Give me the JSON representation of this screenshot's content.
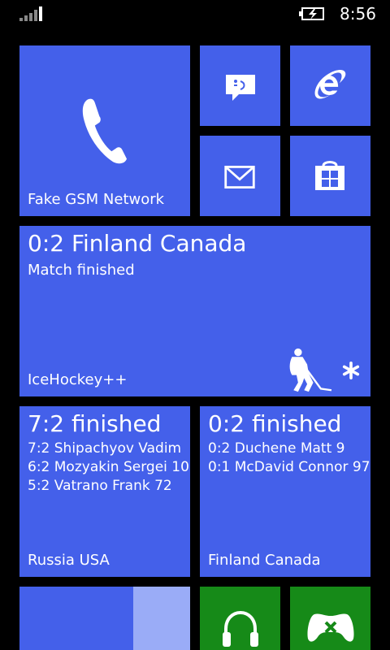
{
  "status_bar": {
    "time": "8:56",
    "signal_icon": "cellular-signal-icon",
    "battery_icon": "battery-charging-icon"
  },
  "tiles": {
    "phone": {
      "label": "Fake GSM Network",
      "icon": "phone-icon"
    },
    "messaging": {
      "icon": "messaging-icon"
    },
    "internet_explorer": {
      "icon": "internet-explorer-icon"
    },
    "mail": {
      "icon": "mail-icon"
    },
    "store": {
      "icon": "store-icon"
    },
    "icehockey": {
      "title": "0:2 Finland Canada",
      "subtitle": "Match finished",
      "label": "IceHockey++",
      "icon": "hockey-player-icon",
      "badge_icon": "asterisk-icon"
    },
    "russia_usa": {
      "title": "7:2 finished",
      "lines": [
        "7:2 Shipachyov Vadim",
        "6:2 Mozyakin Sergei 10",
        "5:2 Vatrano Frank 72"
      ],
      "label": "Russia USA"
    },
    "finland_canada": {
      "title": "0:2 finished",
      "lines": [
        "0:2 Duchene Matt 9",
        "0:1 McDavid Connor 97"
      ],
      "label": "Finland Canada"
    },
    "music": {
      "icon": "headphones-icon"
    },
    "xbox": {
      "icon": "xbox-controller-icon"
    }
  },
  "colors": {
    "accent": "#4460ea",
    "accent_light": "#9aacf7",
    "xbox_green": "#168a18",
    "background": "#000000"
  }
}
